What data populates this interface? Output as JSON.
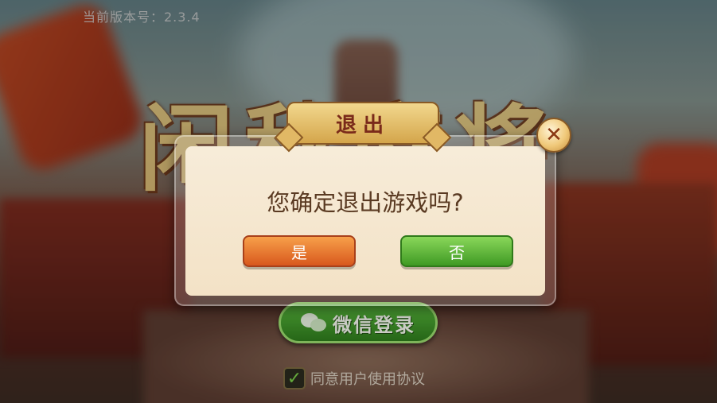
{
  "version_label": "当前版本号：2.3.4",
  "title_art": "闲秋麻将",
  "wechat_login": {
    "label": "微信登录",
    "icon": "wechat-icon"
  },
  "agreement": {
    "label": "同意用户使用协议",
    "checked": true
  },
  "dialog": {
    "title": "退出",
    "message": "您确定退出游戏吗?",
    "yes_label": "是",
    "no_label": "否",
    "close_icon": "close-icon"
  },
  "colors": {
    "yes_button": "#e2762f",
    "no_button": "#5eb53a",
    "dialog_body": "#f5e8d2",
    "title_text": "#7a2a1a"
  }
}
